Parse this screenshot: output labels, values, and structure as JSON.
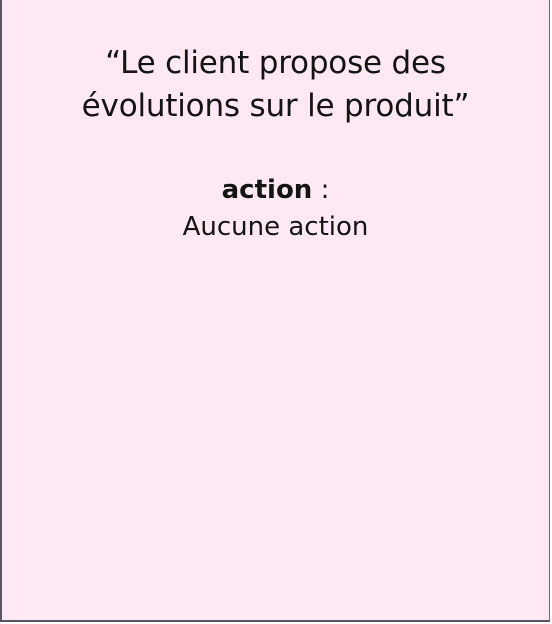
{
  "card": {
    "quote_line1": "“Le client propose des",
    "quote_line2": "évolutions sur le produit”",
    "action_label": "action",
    "action_separator": " :",
    "action_value": "Aucune action"
  },
  "colors": {
    "card_background": "#fde8f3",
    "border": "#5a5560",
    "text": "#141414"
  }
}
